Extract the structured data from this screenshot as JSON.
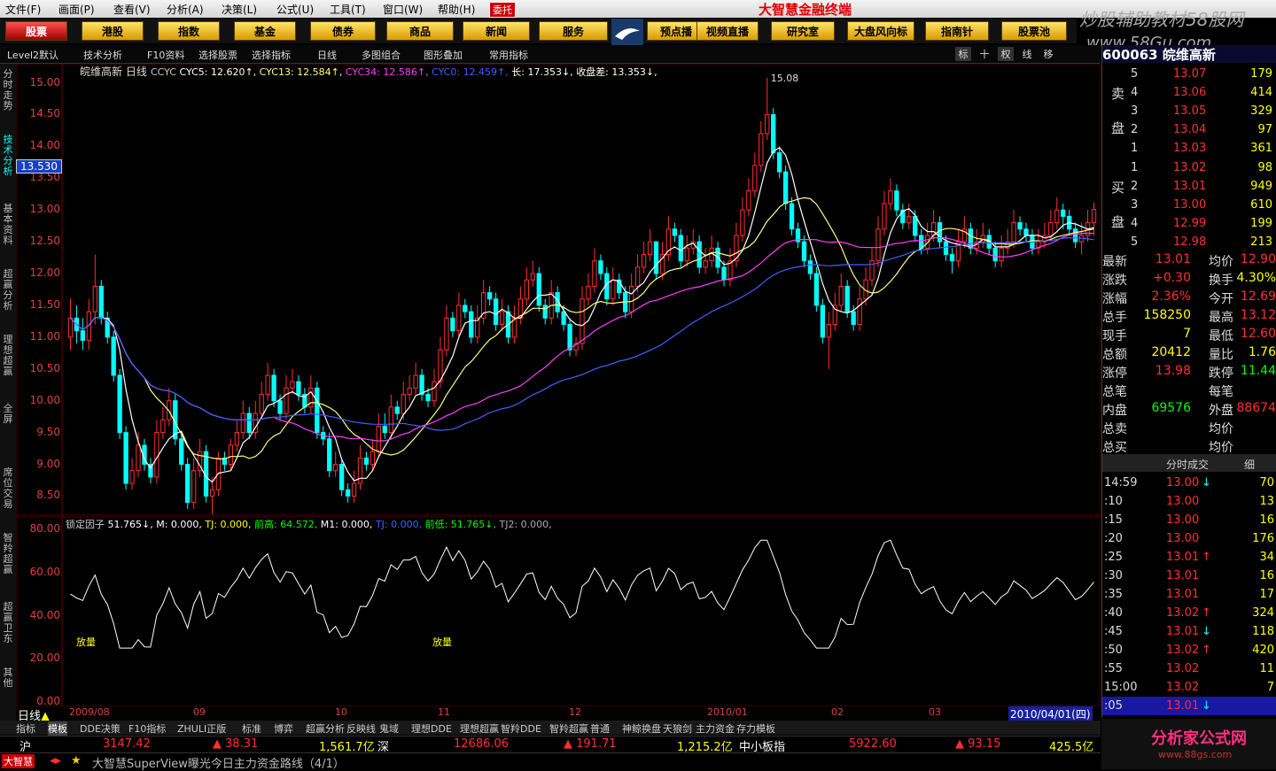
{
  "menu": {
    "items": [
      "文件(F)",
      "画面(P)",
      "查看(V)",
      "分析(A)",
      "决策(L)",
      "公式(U)",
      "工具(T)",
      "窗口(W)",
      "帮助(H)"
    ],
    "entrust": "委托",
    "brand": "大智慧金融终端",
    "watermark": "炒股辅助教材58股网",
    "watermark_url": "www.58Gu.com"
  },
  "nav": {
    "buttons": [
      "股票",
      "港股",
      "指数",
      "基金",
      "债券",
      "商品",
      "新闻",
      "服务",
      "预点播",
      "视频直播",
      "研究室",
      "大盘风向标",
      "指南针",
      "股票池"
    ]
  },
  "toolbar": {
    "items": [
      "Level2默认",
      "技术分析",
      "F10资料",
      "选择股票",
      "选择指标",
      "日线",
      "多图组合",
      "图形叠加",
      "常用指标"
    ],
    "right": [
      "标",
      "十",
      "权",
      "线",
      "移"
    ]
  },
  "vtabs": [
    "分时走势",
    "技术分析",
    "基本资料",
    "超赢分析",
    "理想超赢",
    "全屏",
    "席位交易",
    "智羚超赢",
    "超赢卫东",
    "其他"
  ],
  "stock": {
    "code": "600063",
    "name": "皖维高新",
    "period": "日线"
  },
  "ma_info": {
    "name": "CCYC",
    "items": [
      {
        "label": "CYC5: 12.620↑,",
        "color": "#ffffff"
      },
      {
        "label": "CYC13: 12.584↑,",
        "color": "#ffff80"
      },
      {
        "label": "CYC34: 12.586↑,",
        "color": "#ff40ff"
      },
      {
        "label": "CYC0: 12.459↑,",
        "color": "#4060ff"
      },
      {
        "label": "长: 17.353↓,",
        "color": "#ffffff"
      },
      {
        "label": "收盘差: 13.353↓,",
        "color": "#ffffff"
      }
    ]
  },
  "price_axis": [
    "15.00",
    "14.50",
    "14.00",
    "13.50",
    "13.00",
    "12.50",
    "12.00",
    "11.50",
    "11.00",
    "10.50",
    "10.00",
    "9.50",
    "9.00",
    "8.50"
  ],
  "current_price": "13.530",
  "high_label": "15.08",
  "low_label": "8.22",
  "ind_info": {
    "name": "锁定因子",
    "items": [
      {
        "label": "51.765↓,",
        "color": "#ffffff"
      },
      {
        "label": "M: 0.000,",
        "color": "#ffffff"
      },
      {
        "label": "TJ: 0.000,",
        "color": "#ffff00"
      },
      {
        "label": "前高: 64.572,",
        "color": "#00ff00"
      },
      {
        "label": "M1: 0.000,",
        "color": "#ffffff"
      },
      {
        "label": "TJ: 0.000,",
        "color": "#4060ff"
      },
      {
        "label": "前低: 51.765↓,",
        "color": "#00ff00"
      },
      {
        "label": "TJ2: 0.000,",
        "color": "#aaaaaa"
      }
    ]
  },
  "ind_axis": [
    "80.00",
    "60.00",
    "40.00",
    "20.00",
    "0.00"
  ],
  "ind_labels": [
    "放量",
    "放量"
  ],
  "date_axis": {
    "labels": [
      "2009/08",
      "09",
      "10",
      "11",
      "12",
      "2010/01",
      "02",
      "03"
    ],
    "current": "2010/04/01(四)",
    "period": "日线"
  },
  "ind_tabs": [
    "指标",
    "模板",
    "DDE决策",
    "F10指标",
    "ZHULI正版",
    "标准",
    "博弈",
    "超赢分析",
    "反映线",
    "鬼域",
    "理想DDE",
    "理想超赢",
    "智羚DDE",
    "智羚超赢",
    "普通",
    "神鲸换盘",
    "天狼剑",
    "主力资金",
    "存力模板"
  ],
  "status1": {
    "sh": "沪",
    "sh_index": "3147.42",
    "sh_chg": "▲ 38.31",
    "sh_amt": "1,561.7亿",
    "sz": "深",
    "sz_index": "12686.06",
    "sz_chg": "▲ 191.71",
    "sz_amt": "1,215.2亿",
    "sme": "中小板指",
    "sme_index": "5922.60",
    "sme_chg": "▲ 93.15",
    "sme_amt": "425.5亿"
  },
  "status2": {
    "logo": "大智慧",
    "news": "大智慧SuperView曝光今日主力资金路线（4/1）"
  },
  "right_panel": {
    "header": "600063 皖维高新",
    "sell_label": "卖盘",
    "buy_label": "买盘",
    "sell": [
      {
        "n": "5",
        "p": "13.07",
        "v": "179"
      },
      {
        "n": "4",
        "p": "13.06",
        "v": "414"
      },
      {
        "n": "3",
        "p": "13.05",
        "v": "329"
      },
      {
        "n": "2",
        "p": "13.04",
        "v": "97"
      },
      {
        "n": "1",
        "p": "13.03",
        "v": "361"
      }
    ],
    "buy": [
      {
        "n": "1",
        "p": "13.02",
        "v": "98"
      },
      {
        "n": "2",
        "p": "13.01",
        "v": "949"
      },
      {
        "n": "3",
        "p": "13.00",
        "v": "610"
      },
      {
        "n": "4",
        "p": "12.99",
        "v": "199"
      },
      {
        "n": "5",
        "p": "12.98",
        "v": "213"
      }
    ],
    "quote": [
      {
        "l1": "最新",
        "v1": "13.01",
        "l2": "均价",
        "v2": "12.90",
        "c1": "#ff3030",
        "c2": "#ff3030"
      },
      {
        "l1": "涨跌",
        "v1": "+0.30",
        "l2": "换手",
        "v2": "4.30%",
        "c1": "#ff3030",
        "c2": "#ffff00"
      },
      {
        "l1": "涨幅",
        "v1": "2.36%",
        "l2": "今开",
        "v2": "12.69",
        "c1": "#ff3030",
        "c2": "#ff3030"
      },
      {
        "l1": "总手",
        "v1": "158250",
        "l2": "最高",
        "v2": "13.12",
        "c1": "#ffff00",
        "c2": "#ff3030"
      },
      {
        "l1": "现手",
        "v1": "7",
        "l2": "最低",
        "v2": "12.60",
        "c1": "#ffff00",
        "c2": "#ff3030"
      },
      {
        "l1": "总额",
        "v1": "20412",
        "l2": "量比",
        "v2": "1.76",
        "c1": "#ffff00",
        "c2": "#ffff00"
      },
      {
        "l1": "涨停",
        "v1": "13.98",
        "l2": "跌停",
        "v2": "11.44",
        "c1": "#ff3030",
        "c2": "#00ff00"
      },
      {
        "l1": "总笔",
        "v1": "",
        "l2": "每笔",
        "v2": "",
        "c1": "#ffff00",
        "c2": "#ffff00"
      },
      {
        "l1": "内盘",
        "v1": "69576",
        "l2": "外盘",
        "v2": "88674",
        "c1": "#00ff00",
        "c2": "#ff3030"
      },
      {
        "l1": "总卖",
        "v1": "",
        "l2": "均价",
        "v2": "",
        "c1": "#ffff00",
        "c2": "#ffff00"
      },
      {
        "l1": "总买",
        "v1": "",
        "l2": "均价",
        "v2": "",
        "c1": "#ffff00",
        "c2": "#ffff00"
      }
    ],
    "trades_title": "分时成交",
    "trades_btn": "细",
    "trades": [
      {
        "t": "14:59",
        "p": "13.00",
        "a": "↓",
        "v": "70"
      },
      {
        "t": ":10",
        "p": "13.00",
        "a": "",
        "v": "13"
      },
      {
        "t": ":15",
        "p": "13.00",
        "a": "",
        "v": "16"
      },
      {
        "t": ":20",
        "p": "13.00",
        "a": "",
        "v": "176"
      },
      {
        "t": ":25",
        "p": "13.01",
        "a": "↑",
        "v": "34"
      },
      {
        "t": ":30",
        "p": "13.01",
        "a": "",
        "v": "16"
      },
      {
        "t": ":35",
        "p": "13.01",
        "a": "",
        "v": "17"
      },
      {
        "t": ":40",
        "p": "13.02",
        "a": "↑",
        "v": "324"
      },
      {
        "t": ":45",
        "p": "13.01",
        "a": "↓",
        "v": "118"
      },
      {
        "t": ":50",
        "p": "13.02",
        "a": "↑",
        "v": "420"
      },
      {
        "t": ":55",
        "p": "13.02",
        "a": "",
        "v": "11"
      },
      {
        "t": "15:00",
        "p": "13.02",
        "a": "",
        "v": "7"
      },
      {
        "t": ":05",
        "p": "13.01",
        "a": "↓",
        "v": ""
      }
    ]
  },
  "advert": {
    "text": "分析家公式网",
    "url": "www.88gs.com"
  },
  "colors": {
    "up": "#ff3030",
    "down": "#00ffff",
    "ma5": "#ffffff",
    "ma13": "#ffff80",
    "ma34": "#ff40ff",
    "ma0": "#4060ff"
  },
  "chart_data": {
    "type": "candlestick",
    "title": "皖维高新 日线",
    "ylim": [
      8.2,
      15.3
    ],
    "dates": [
      "2009/07/23",
      "2009/07/24",
      "2009/07/27",
      "2009/07/28",
      "2009/07/29",
      "2009/07/30",
      "2009/07/31",
      "2009/08/03",
      "2009/08/04",
      "2009/08/05",
      "2009/08/06",
      "2009/08/07",
      "2009/08/10",
      "2009/08/11",
      "2009/08/12",
      "2009/08/13",
      "2009/08/14",
      "2009/08/17",
      "2009/08/18",
      "2009/08/19",
      "2009/08/20",
      "2009/08/21",
      "2009/08/24",
      "2009/08/25",
      "2009/08/26",
      "2009/08/27",
      "2009/08/28",
      "2009/08/31",
      "2009/09/01",
      "2009/09/02",
      "2009/09/03",
      "2009/09/04",
      "2009/09/07",
      "2009/09/08",
      "2009/09/09",
      "2009/09/10",
      "2009/09/11",
      "2009/09/14",
      "2009/09/15",
      "2009/09/16",
      "2009/09/17",
      "2009/09/18",
      "2009/09/21",
      "2009/09/22",
      "2009/09/23",
      "2009/09/24",
      "2009/09/25",
      "2009/09/28",
      "2009/09/29",
      "2009/09/30",
      "2009/10/09",
      "2009/10/12",
      "2009/10/13",
      "2009/10/14",
      "2009/10/15",
      "2009/10/16",
      "2009/10/19",
      "2009/10/20",
      "2009/10/21",
      "2009/10/22",
      "2009/10/23",
      "2009/10/26",
      "2009/10/27",
      "2009/10/28",
      "2009/10/29",
      "2009/10/30",
      "2009/11/02",
      "2009/11/03",
      "2009/11/04",
      "2009/11/05",
      "2009/11/06",
      "2009/11/09",
      "2009/11/10",
      "2009/11/11",
      "2009/11/12",
      "2009/11/13",
      "2009/11/16",
      "2009/11/17",
      "2009/11/18",
      "2009/11/19",
      "2009/11/20",
      "2009/11/23",
      "2009/11/24",
      "2009/11/25",
      "2009/11/26",
      "2009/11/27",
      "2009/11/30",
      "2009/12/01",
      "2009/12/02",
      "2009/12/03",
      "2009/12/04",
      "2009/12/07",
      "2009/12/08",
      "2009/12/09",
      "2009/12/10",
      "2009/12/11",
      "2009/12/14",
      "2009/12/15",
      "2009/12/16",
      "2009/12/17",
      "2009/12/18",
      "2009/12/21",
      "2009/12/22",
      "2009/12/23",
      "2009/12/24",
      "2009/12/25",
      "2009/12/28",
      "2009/12/29",
      "2009/12/30",
      "2009/12/31",
      "2010/01/04",
      "2010/01/05",
      "2010/01/06",
      "2010/01/07",
      "2010/01/08",
      "2010/01/11",
      "2010/01/12",
      "2010/01/13",
      "2010/01/14",
      "2010/01/15",
      "2010/01/18",
      "2010/01/19",
      "2010/01/20",
      "2010/01/21",
      "2010/01/22",
      "2010/01/25",
      "2010/01/26",
      "2010/01/27",
      "2010/01/28",
      "2010/01/29",
      "2010/02/01",
      "2010/02/02",
      "2010/02/03",
      "2010/02/04",
      "2010/02/05",
      "2010/02/08",
      "2010/02/09",
      "2010/02/10",
      "2010/02/11",
      "2010/02/12",
      "2010/02/22",
      "2010/02/23",
      "2010/02/24",
      "2010/02/25",
      "2010/02/26",
      "2010/03/01",
      "2010/03/02",
      "2010/03/03",
      "2010/03/04",
      "2010/03/05",
      "2010/03/08",
      "2010/03/09",
      "2010/03/10",
      "2010/03/11",
      "2010/03/12",
      "2010/03/15",
      "2010/03/16",
      "2010/03/17",
      "2010/03/18",
      "2010/03/19",
      "2010/03/22",
      "2010/03/23",
      "2010/03/24",
      "2010/03/25",
      "2010/03/26",
      "2010/03/29",
      "2010/03/30",
      "2010/03/31",
      "2010/04/01"
    ],
    "close": [
      11.3,
      11.1,
      10.95,
      11.4,
      11.8,
      11.3,
      11.0,
      10.4,
      9.5,
      8.7,
      8.9,
      9.3,
      9.0,
      8.8,
      9.5,
      9.7,
      10.0,
      9.4,
      9.0,
      8.4,
      8.9,
      9.2,
      8.5,
      8.6,
      9.1,
      9.0,
      9.3,
      9.5,
      9.8,
      9.5,
      9.8,
      10.1,
      10.4,
      10.0,
      9.8,
      10.2,
      10.3,
      10.1,
      9.9,
      10.2,
      9.5,
      9.4,
      8.9,
      9.0,
      8.6,
      8.5,
      8.7,
      9.1,
      9.0,
      9.2,
      9.6,
      9.5,
      9.9,
      9.8,
      10.1,
      10.2,
      10.4,
      10.1,
      10.0,
      10.3,
      10.8,
      11.3,
      11.1,
      11.5,
      11.4,
      11.0,
      11.3,
      11.7,
      11.6,
      11.2,
      11.4,
      11.0,
      11.3,
      11.6,
      11.9,
      12.0,
      11.5,
      11.3,
      11.7,
      11.4,
      11.2,
      10.8,
      10.9,
      11.6,
      11.8,
      12.2,
      12.0,
      11.6,
      11.9,
      11.7,
      11.4,
      11.8,
      12.1,
      12.3,
      12.5,
      12.0,
      12.3,
      12.7,
      12.6,
      12.2,
      12.4,
      12.5,
      12.1,
      12.2,
      12.4,
      12.1,
      11.9,
      12.2,
      12.6,
      13.0,
      13.3,
      13.7,
      14.2,
      14.5,
      13.9,
      13.6,
      13.1,
      12.7,
      12.5,
      12.2,
      12.0,
      11.5,
      11.0,
      11.2,
      11.5,
      11.8,
      11.4,
      11.2,
      11.6,
      11.9,
      12.2,
      12.7,
      13.1,
      13.3,
      13.0,
      12.8,
      12.9,
      12.6,
      12.4,
      12.6,
      12.8,
      12.5,
      12.3,
      12.2,
      12.5,
      12.7,
      12.4,
      12.5,
      12.6,
      12.4,
      12.2,
      12.4,
      12.5,
      12.8,
      12.7,
      12.6,
      12.4,
      12.5,
      12.6,
      12.8,
      13.0,
      12.9,
      12.7,
      12.5,
      12.6,
      12.8,
      13.01
    ],
    "open": [
      11.0,
      11.3,
      11.1,
      10.95,
      11.4,
      11.8,
      11.3,
      11.0,
      10.4,
      9.5,
      8.7,
      8.9,
      9.3,
      9.0,
      8.8,
      9.5,
      9.7,
      10.0,
      9.4,
      9.0,
      8.4,
      8.9,
      9.2,
      8.5,
      8.6,
      9.1,
      9.0,
      9.3,
      9.5,
      9.8,
      9.5,
      9.8,
      10.1,
      10.4,
      10.0,
      9.8,
      10.2,
      10.3,
      10.1,
      9.9,
      10.2,
      9.5,
      9.4,
      8.9,
      9.0,
      8.6,
      8.5,
      8.7,
      9.1,
      9.0,
      9.2,
      9.6,
      9.5,
      9.9,
      9.8,
      10.1,
      10.2,
      10.4,
      10.1,
      10.0,
      10.3,
      10.8,
      11.3,
      11.1,
      11.5,
      11.4,
      11.0,
      11.3,
      11.7,
      11.6,
      11.2,
      11.4,
      11.0,
      11.3,
      11.6,
      11.9,
      12.0,
      11.5,
      11.3,
      11.7,
      11.4,
      11.2,
      10.8,
      10.9,
      11.6,
      11.8,
      12.2,
      12.0,
      11.6,
      11.9,
      11.7,
      11.4,
      11.8,
      12.1,
      12.3,
      12.5,
      12.0,
      12.3,
      12.7,
      12.6,
      12.2,
      12.4,
      12.5,
      12.1,
      12.2,
      12.4,
      12.1,
      11.9,
      12.2,
      12.6,
      13.0,
      13.3,
      13.7,
      14.2,
      14.5,
      13.9,
      13.6,
      13.1,
      12.7,
      12.5,
      12.2,
      12.0,
      11.5,
      11.0,
      11.2,
      11.5,
      11.8,
      11.4,
      11.2,
      11.6,
      11.9,
      12.2,
      12.7,
      13.1,
      13.3,
      13.0,
      12.8,
      12.9,
      12.6,
      12.4,
      12.6,
      12.8,
      12.5,
      12.3,
      12.2,
      12.5,
      12.7,
      12.4,
      12.5,
      12.6,
      12.4,
      12.2,
      12.4,
      12.5,
      12.8,
      12.7,
      12.6,
      12.4,
      12.5,
      12.6,
      12.8,
      13.0,
      12.9,
      12.7,
      12.5,
      12.6,
      12.8
    ],
    "high": [
      11.6,
      11.5,
      11.3,
      11.6,
      12.3,
      11.9,
      11.4,
      11.1,
      10.5,
      9.6,
      9.1,
      9.5,
      9.4,
      9.1,
      9.7,
      9.9,
      10.2,
      10.1,
      9.5,
      9.1,
      9.1,
      9.4,
      9.3,
      8.8,
      9.2,
      9.2,
      9.4,
      9.7,
      10.0,
      9.9,
      10.0,
      10.3,
      10.6,
      10.5,
      10.1,
      10.4,
      10.5,
      10.4,
      10.2,
      10.4,
      10.3,
      9.6,
      9.5,
      9.2,
      9.1,
      8.7,
      8.9,
      9.3,
      9.2,
      9.4,
      9.8,
      9.8,
      10.1,
      10.0,
      10.3,
      10.4,
      10.6,
      10.5,
      10.2,
      10.5,
      11.0,
      11.5,
      11.4,
      11.7,
      11.6,
      11.5,
      11.5,
      11.9,
      11.8,
      11.7,
      11.6,
      11.5,
      11.5,
      11.8,
      12.1,
      12.2,
      12.1,
      11.6,
      11.9,
      11.8,
      11.5,
      11.3,
      11.0,
      11.8,
      12.0,
      12.4,
      12.3,
      12.1,
      12.1,
      12.0,
      11.8,
      12.0,
      12.3,
      12.5,
      12.7,
      12.5,
      12.5,
      12.9,
      12.8,
      12.7,
      12.6,
      12.7,
      12.6,
      12.4,
      12.6,
      12.5,
      12.2,
      12.4,
      12.8,
      13.2,
      13.5,
      13.9,
      14.4,
      15.08,
      14.6,
      14.0,
      13.7,
      13.2,
      12.8,
      12.6,
      12.3,
      12.1,
      11.6,
      11.4,
      11.7,
      12.0,
      11.9,
      11.5,
      11.8,
      12.1,
      12.4,
      12.9,
      13.3,
      13.5,
      13.4,
      13.1,
      13.1,
      13.0,
      12.7,
      12.8,
      13.0,
      12.9,
      12.6,
      12.4,
      12.7,
      12.9,
      12.8,
      12.7,
      12.8,
      12.7,
      12.5,
      12.6,
      12.7,
      13.0,
      12.9,
      12.8,
      12.7,
      12.7,
      12.8,
      13.0,
      13.2,
      13.1,
      13.0,
      12.8,
      12.8,
      13.0,
      13.12
    ],
    "low": [
      10.8,
      10.9,
      10.8,
      10.8,
      11.2,
      11.2,
      10.9,
      10.3,
      9.4,
      8.6,
      8.6,
      8.8,
      8.9,
      8.7,
      8.7,
      9.4,
      9.6,
      9.3,
      8.9,
      8.3,
      8.3,
      8.8,
      8.4,
      8.22,
      8.5,
      8.9,
      8.9,
      9.2,
      9.4,
      9.4,
      9.4,
      9.7,
      10.0,
      9.9,
      9.7,
      9.7,
      10.1,
      10.0,
      9.8,
      9.8,
      9.4,
      9.3,
      8.8,
      8.8,
      8.5,
      8.4,
      8.4,
      8.6,
      8.9,
      8.9,
      9.1,
      9.4,
      9.4,
      9.7,
      9.7,
      10.0,
      10.1,
      10.0,
      9.9,
      9.9,
      10.2,
      10.7,
      11.0,
      11.0,
      11.3,
      10.9,
      10.9,
      11.2,
      11.5,
      11.1,
      11.1,
      10.9,
      10.9,
      11.2,
      11.5,
      11.8,
      11.4,
      11.2,
      11.2,
      11.3,
      11.1,
      10.7,
      10.7,
      10.8,
      11.5,
      11.7,
      11.9,
      11.5,
      11.5,
      11.6,
      11.3,
      11.3,
      11.7,
      12.0,
      12.2,
      11.9,
      11.9,
      12.2,
      12.5,
      12.1,
      12.1,
      12.3,
      12.0,
      12.0,
      12.1,
      12.0,
      11.8,
      11.8,
      12.1,
      12.5,
      12.9,
      13.2,
      13.6,
      14.1,
      13.8,
      13.5,
      13.0,
      12.6,
      12.4,
      12.1,
      11.9,
      11.4,
      10.9,
      10.5,
      11.1,
      11.4,
      11.3,
      11.1,
      11.1,
      11.5,
      11.8,
      12.1,
      12.6,
      13.0,
      12.9,
      12.7,
      12.7,
      12.5,
      12.3,
      12.3,
      12.5,
      12.4,
      12.2,
      12.0,
      12.1,
      12.4,
      12.3,
      12.3,
      12.4,
      12.3,
      12.1,
      12.1,
      12.3,
      12.4,
      12.6,
      12.5,
      12.3,
      12.3,
      12.4,
      12.5,
      12.7,
      12.7,
      12.6,
      12.4,
      12.3,
      12.5,
      12.6
    ]
  }
}
